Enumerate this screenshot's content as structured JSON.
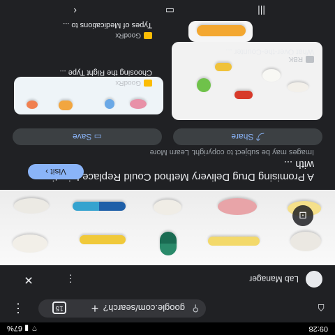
{
  "status": {
    "time": "09:28",
    "battery": "67%"
  },
  "browser": {
    "url": "google.com/search?",
    "tab_count": "15"
  },
  "lens": {
    "title": "Lab Manager"
  },
  "result": {
    "title": "A Promising Drug Delivery Method Could Replace Injections with ...",
    "visit_label": "Visit",
    "copyright": "Images may be subject to copyright. Learn More",
    "share_label": "Share",
    "save_label": "Save"
  },
  "related": [
    {
      "title": "What Over-the-Counter ...",
      "source": "RBK"
    },
    {
      "title": "Choosing the Right Type ...",
      "source": "GoodRx"
    },
    {
      "title": "Types of Medications to ...",
      "source": "GoodRx"
    }
  ],
  "colors": {
    "accent": "#8ab4f8",
    "background": "#202124",
    "surface": "#3c4043"
  }
}
